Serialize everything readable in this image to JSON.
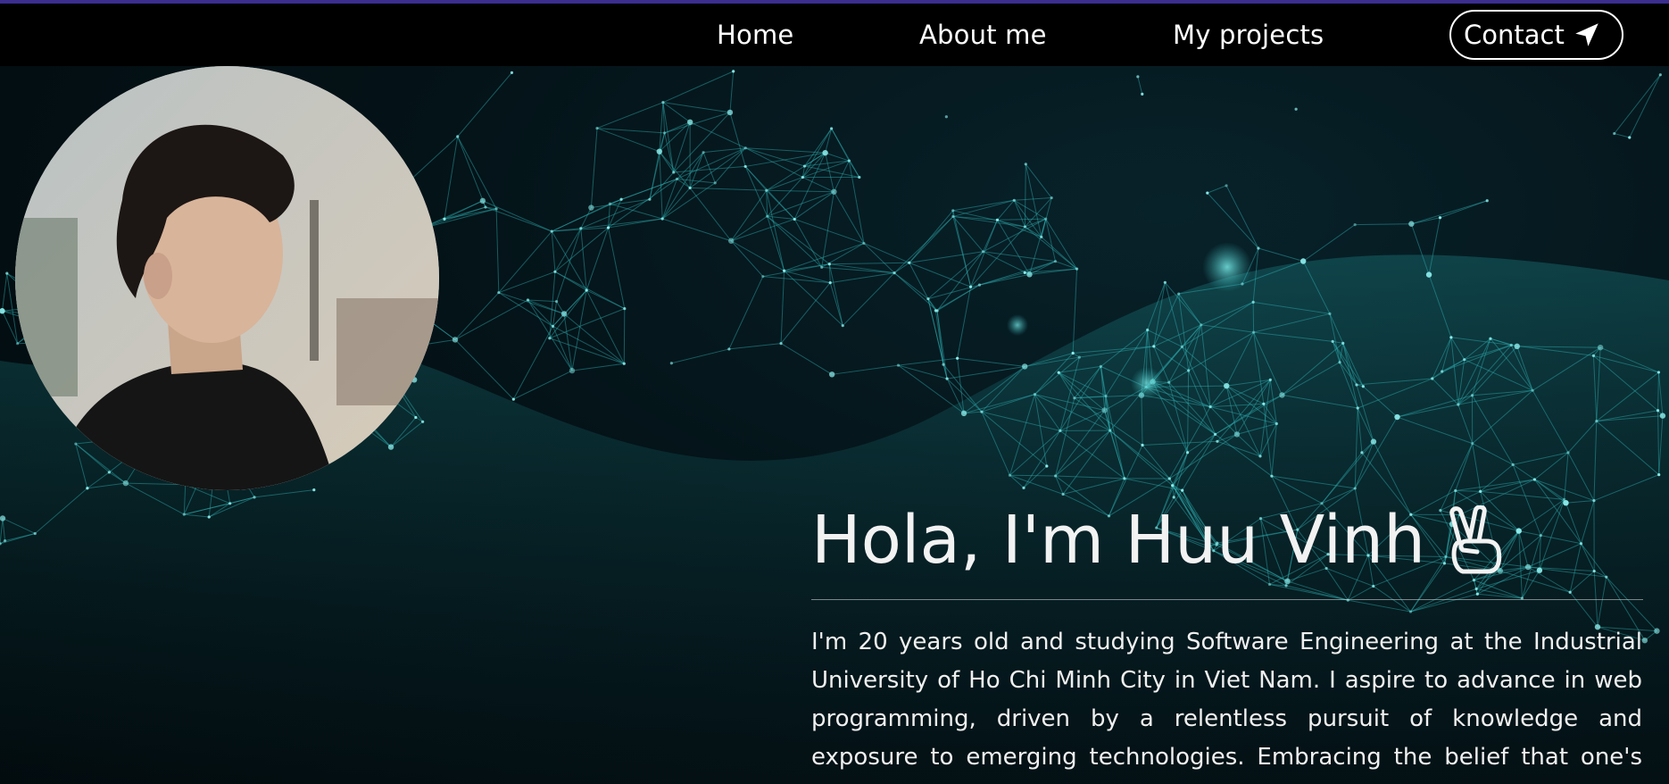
{
  "nav": {
    "home_label": "Home",
    "about_label": "About me",
    "projects_label": "My projects",
    "contact_label": "Contact",
    "contact_icon": "paper-plane-icon"
  },
  "hero": {
    "headline": "Hola, I'm Huu Vinh",
    "headline_icon": "peace-hand-icon",
    "intro": "I'm 20 years old and studying Software Engineering at the Industrial University of Ho Chi Minh City in Viet Nam. I aspire to advance in web programming, driven by a relentless pursuit of knowledge and exposure to emerging technologies. Embracing the belief that one's limits are boundless, I continuous learning"
  },
  "colors": {
    "accent_strip": "#3b2e8f",
    "network_line": "#2fb3b5",
    "background": "#041318"
  }
}
